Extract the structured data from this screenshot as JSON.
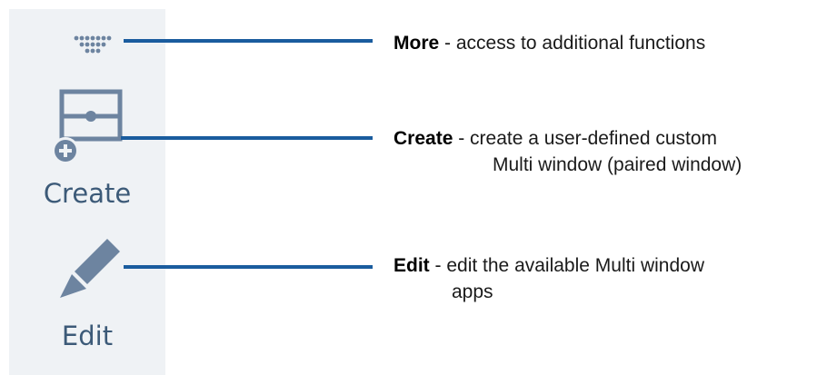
{
  "colors": {
    "panel_bg": "#eff2f5",
    "icon": "#6d84a0",
    "label": "#3c5a78",
    "leader_line": "#1a5c9e",
    "text": "#1a1a1a"
  },
  "sidebar": {
    "more": {
      "icon": "more-dots-icon"
    },
    "create": {
      "icon": "create-window-icon",
      "label": "Create"
    },
    "edit": {
      "icon": "pencil-icon",
      "label": "Edit"
    }
  },
  "callouts": {
    "more": {
      "term": "More",
      "separator": " - ",
      "text": "access to additional functions"
    },
    "create": {
      "term": "Create",
      "separator": " - ",
      "text": "create a user-defined custom",
      "continuation": "Multi window (paired window)"
    },
    "edit": {
      "term": "Edit",
      "separator": " - ",
      "text": "edit the available Multi window",
      "continuation": "apps"
    }
  }
}
